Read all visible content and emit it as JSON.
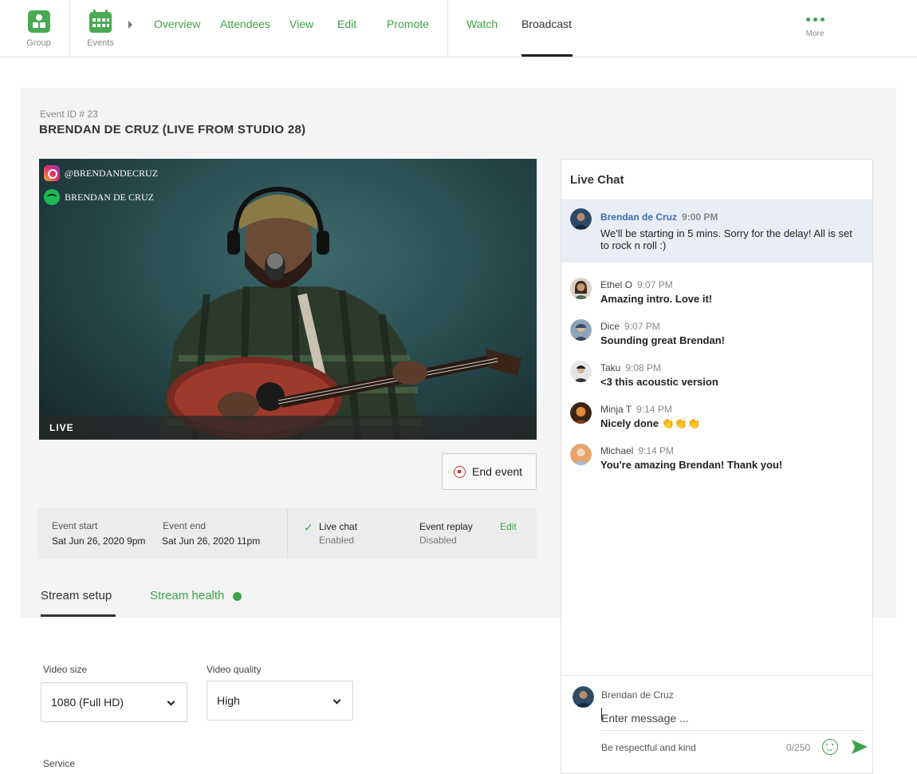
{
  "nav": {
    "group_label": "Group",
    "events_label": "Events",
    "links": [
      "Overview",
      "Attendees",
      "View",
      "Edit",
      "Promote"
    ],
    "watch_label": "Watch",
    "broadcast_label": "Broadcast",
    "more_label": "More",
    "accent_color": "#3ea34a"
  },
  "event": {
    "id_label": "Event ID # 23",
    "title": "BRENDAN DE CRUZ (LIVE FROM STUDIO 28)"
  },
  "video": {
    "instagram_handle": "@BRENDANDECRUZ",
    "spotify_name": "BRENDAN DE CRUZ",
    "live_label": "LIVE"
  },
  "end_event_label": "End event",
  "info": {
    "start_label": "Event start",
    "start_value": "Sat Jun 26, 2020 9pm",
    "end_label": "Event end",
    "end_value": "Sat Jun 26, 2020 11pm",
    "chat_label": "Live chat",
    "chat_status": "Enabled",
    "replay_label": "Event replay",
    "replay_status": "Disabled",
    "edit_label": "Edit"
  },
  "stream_tabs": {
    "setup": "Stream setup",
    "health": "Stream health",
    "health_status_color": "#3ea34a"
  },
  "form": {
    "video_size_label": "Video size",
    "video_size_value": "1080 (Full HD)",
    "video_quality_label": "Video quality",
    "video_quality_value": "High",
    "service_label": "Service"
  },
  "chat": {
    "title": "Live Chat",
    "pinned": {
      "name": "Brendan de Cruz",
      "time": "9:00 PM",
      "text": "We'll be starting in 5 mins. Sorry for the delay! All is set to rock n roll :)"
    },
    "messages": [
      {
        "name": "Ethel O",
        "time": "9:07 PM",
        "text": "Amazing intro. Love it!"
      },
      {
        "name": "Dice",
        "time": "9:07 PM",
        "text": "Sounding great Brendan!"
      },
      {
        "name": "Taku",
        "time": "9:08 PM",
        "text": "<3 this acoustic version"
      },
      {
        "name": "Minja T",
        "time": "9:14 PM",
        "text": "Nicely done 👏👏👏"
      },
      {
        "name": "Michael",
        "time": "9:14 PM",
        "text": "You're amazing Brendan! Thank you!"
      }
    ],
    "compose": {
      "user_name": "Brendan de Cruz",
      "placeholder": "Enter message ...",
      "hint": "Be respectful and kind",
      "counter": "0/250"
    }
  }
}
